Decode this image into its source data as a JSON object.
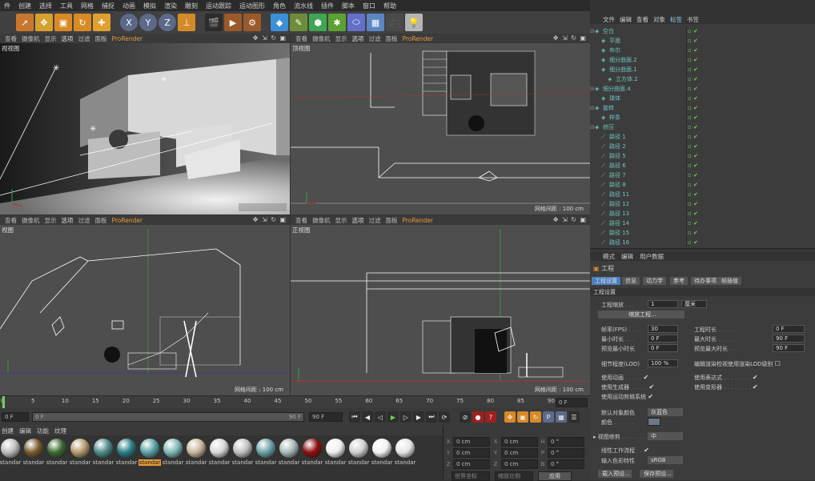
{
  "menu": [
    "件",
    "创建",
    "选择",
    "工具",
    "网格",
    "捕捉",
    "动画",
    "模拟",
    "渲染",
    "雕刻",
    "运动跟踪",
    "运动图形",
    "角色",
    "流水线",
    "插件",
    "脚本",
    "窗口",
    "帮助"
  ],
  "viewport_menu": [
    "查看",
    "摄像机",
    "显示",
    "选项",
    "过滤",
    "面板",
    "ProRender"
  ],
  "viewports": [
    {
      "label": "视视图",
      "scale": ""
    },
    {
      "label": "顶视图",
      "scale": "网格间距 : 100 cm"
    },
    {
      "label": "视图",
      "scale": "网格间距 : 100 cm"
    },
    {
      "label": "正视图",
      "scale": "网格间距 : 100 cm"
    }
  ],
  "timeline": {
    "ticks": [
      "0",
      "5",
      "10",
      "15",
      "20",
      "25",
      "30",
      "35",
      "40",
      "45",
      "50",
      "55",
      "60",
      "65",
      "70",
      "75",
      "80",
      "85",
      "90"
    ],
    "end_field": "0 F"
  },
  "timebar": {
    "start": "0 F",
    "slider_start": "0 F",
    "slider_end": "90 F",
    "end": "90 F"
  },
  "materials_menu": [
    "创建",
    "编辑",
    "功能",
    "纹理"
  ],
  "materials": [
    {
      "name": "standar",
      "color": "#bdbdbd"
    },
    {
      "name": "standar",
      "color": "#7a5a2e"
    },
    {
      "name": "standar",
      "color": "#3c6b33"
    },
    {
      "name": "standar",
      "color": "#b59a6c"
    },
    {
      "name": "standar",
      "color": "#4f8a8a"
    },
    {
      "name": "standar",
      "color": "#2b7e86"
    },
    {
      "name": "standar",
      "color": "#5ba2a6",
      "active": true
    },
    {
      "name": "standar",
      "color": "#7fb7b8"
    },
    {
      "name": "standar",
      "color": "#c8b59a"
    },
    {
      "name": "standar",
      "color": "#d8d8d8"
    },
    {
      "name": "standar",
      "color": "#c0c0c0"
    },
    {
      "name": "standar",
      "color": "#6aa2a6"
    },
    {
      "name": "standar",
      "color": "#a8b8b8"
    },
    {
      "name": "standar",
      "color": "#8e1010"
    },
    {
      "name": "standar",
      "color": "#eeeeee"
    },
    {
      "name": "standar",
      "color": "#cfcfcf"
    },
    {
      "name": "standar",
      "color": "#f2f2f2"
    },
    {
      "name": "standar",
      "color": "#e6e6e6"
    }
  ],
  "coords": {
    "rows": [
      [
        "X",
        "0 cm",
        "X",
        "0 cm",
        "H",
        "0 °"
      ],
      [
        "Y",
        "0 cm",
        "Y",
        "0 cm",
        "P",
        "0 °"
      ],
      [
        "Z",
        "0 cm",
        "Z",
        "0 cm",
        "B",
        "0 °"
      ]
    ],
    "mode1": "世界坐标",
    "mode2": "缩放比例",
    "apply": "应用"
  },
  "objmgr_menu": [
    "文件",
    "编辑",
    "查看",
    "对象",
    "标签",
    "书签"
  ],
  "objects": [
    {
      "name": "空白",
      "color": "teal",
      "indent": 0
    },
    {
      "name": "平面",
      "color": "teal",
      "indent": 1
    },
    {
      "name": "布尔",
      "color": "teal",
      "indent": 1
    },
    {
      "name": "细分曲面.2",
      "color": "teal",
      "indent": 1
    },
    {
      "name": "细分曲面.1",
      "color": "teal",
      "indent": 1
    },
    {
      "name": "立方体.2",
      "color": "teal",
      "indent": 2
    },
    {
      "name": "细分曲面.4",
      "color": "teal",
      "indent": 0
    },
    {
      "name": "球体",
      "color": "teal",
      "indent": 1
    },
    {
      "name": "旋转",
      "color": "teal",
      "indent": 0
    },
    {
      "name": "样条",
      "color": "teal",
      "indent": 1
    },
    {
      "name": "挤压",
      "color": "teal",
      "indent": 0
    },
    {
      "name": "路径 1",
      "color": "teal",
      "indent": 1
    },
    {
      "name": "路径 2",
      "color": "teal",
      "indent": 1
    },
    {
      "name": "路径 5",
      "color": "teal",
      "indent": 1
    },
    {
      "name": "路径 6",
      "color": "teal",
      "indent": 1
    },
    {
      "name": "路径 7",
      "color": "teal",
      "indent": 1
    },
    {
      "name": "路径 8",
      "color": "teal",
      "indent": 1
    },
    {
      "name": "路径 11",
      "color": "teal",
      "indent": 1
    },
    {
      "name": "路径 12",
      "color": "teal",
      "indent": 1
    },
    {
      "name": "路径 13",
      "color": "teal",
      "indent": 1
    },
    {
      "name": "路径 14",
      "color": "teal",
      "indent": 1
    },
    {
      "name": "路径 15",
      "color": "teal",
      "indent": 1
    },
    {
      "name": "路径 16",
      "color": "teal",
      "indent": 1
    }
  ],
  "attr_menu": [
    "模式",
    "编辑",
    "用户数据"
  ],
  "attr_title": "工程",
  "attr_tabs": [
    "工程设置",
    "信息",
    "动力学",
    "参考",
    "待办事项",
    "帧插值"
  ],
  "attr_section": "工程设置",
  "attr": {
    "scale_label": "工程缩放",
    "scale_val": "1",
    "scale_unit": "厘米",
    "scale_btn": "缩放工程...",
    "fps_label": "帧率(FPS)",
    "fps": "30",
    "dur_label": "工程时长",
    "dur": "0 F",
    "min_label": "最小时长",
    "min": "0 F",
    "max_label": "最大时长",
    "max": "90 F",
    "pmin_label": "预览最小时长",
    "pmin": "0 F",
    "pmax_label": "预览最大时长",
    "pmax": "90 F",
    "lod_label": "细节程度(LOD)",
    "lod": "100 %",
    "lod_render": "编辑渲染检视使用渲染LOD级别",
    "anim": "使用动画",
    "expr": "使用表达式",
    "gen": "使用生成器",
    "deform": "使用变形器",
    "motion": "使用运动剪辑系统",
    "objcolor_label": "默认对象颜色",
    "objcolor": "灰蓝色",
    "color_label": "颜色",
    "viewclip_label": "视图修剪",
    "viewclip": "中",
    "linear_label": "线性工作流程",
    "input_label": "输入色彩特性",
    "input": "sRGB",
    "load_btn": "载入预设...",
    "save_btn": "保存预设..."
  }
}
